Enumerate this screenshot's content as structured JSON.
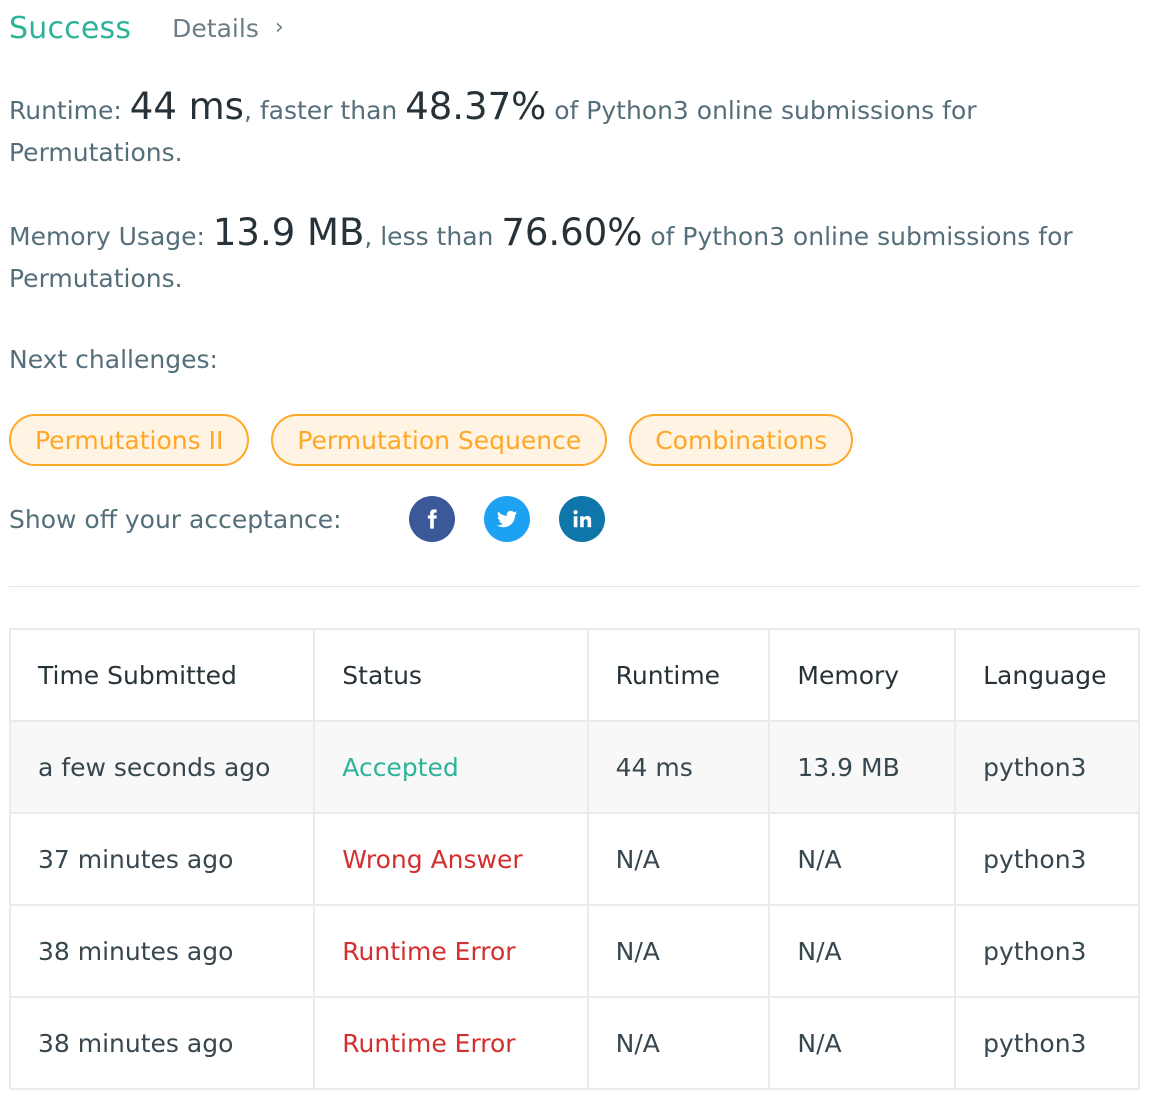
{
  "header": {
    "status": "Success",
    "details_label": "Details",
    "details_chevron": "›"
  },
  "runtime_result": {
    "label": "Runtime:",
    "value": "44 ms",
    "comparison_prefix": ", faster than",
    "percentile": "48.37%",
    "suffix": "of Python3 online submissions for",
    "problem": "Permutations."
  },
  "memory_result": {
    "label": "Memory Usage:",
    "value": "13.9 MB",
    "comparison_prefix": ", less than",
    "percentile": "76.60%",
    "suffix": "of Python3 online submissions for",
    "problem": "Permutations."
  },
  "next_challenges": {
    "label": "Next challenges:",
    "items": [
      {
        "label": "Permutations II"
      },
      {
        "label": "Permutation Sequence"
      },
      {
        "label": "Combinations"
      }
    ]
  },
  "share": {
    "label": "Show off your acceptance:",
    "icons": [
      "facebook-icon",
      "twitter-icon",
      "linkedin-icon"
    ]
  },
  "submissions": {
    "columns": [
      "Time Submitted",
      "Status",
      "Runtime",
      "Memory",
      "Language"
    ],
    "rows": [
      {
        "time": "a few seconds ago",
        "status": "Accepted",
        "runtime": "44 ms",
        "memory": "13.9 MB",
        "language": "python3"
      },
      {
        "time": "37 minutes ago",
        "status": "Wrong Answer",
        "runtime": "N/A",
        "memory": "N/A",
        "language": "python3"
      },
      {
        "time": "38 minutes ago",
        "status": "Runtime Error",
        "runtime": "N/A",
        "memory": "N/A",
        "language": "python3"
      },
      {
        "time": "38 minutes ago",
        "status": "Runtime Error",
        "runtime": "N/A",
        "memory": "N/A",
        "language": "python3"
      }
    ]
  },
  "colors": {
    "success": "#2db39a",
    "error": "#d32f2f",
    "pill_border": "#ffa726",
    "pill_bg": "#fff4e3",
    "facebook": "#3b5998",
    "twitter": "#1da1f2",
    "linkedin": "#0e76a8"
  }
}
